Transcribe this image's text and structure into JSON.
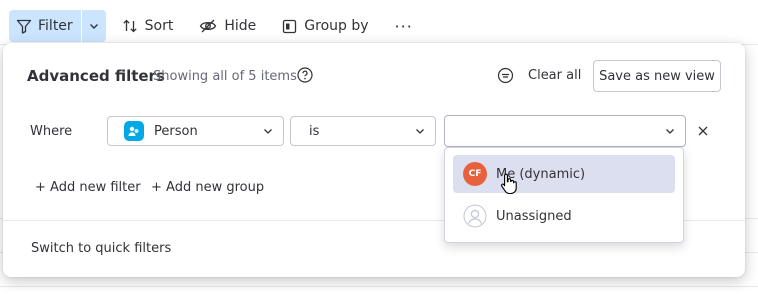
{
  "toolbar": {
    "filter_label": "Filter",
    "sort_label": "Sort",
    "hide_label": "Hide",
    "group_by_label": "Group by",
    "more_label": "···",
    "filter_highlight_color": "#cce5ff"
  },
  "panel": {
    "title": "Advanced filters",
    "subtitle": "Showing all of 5 items",
    "clear_all": "Clear all",
    "save_as_new_view": "Save as new view",
    "where_label": "Where",
    "column_select": {
      "value": "Person",
      "icon": "person-column-icon",
      "icon_color": "#00a9e6"
    },
    "operator_select": {
      "value": "is"
    },
    "value_select": {
      "value": ""
    },
    "add_new_filter": "+ Add new filter",
    "add_new_group": "+ Add new group",
    "switch_to_quick_filters": "Switch to quick filters"
  },
  "dropdown": {
    "options": [
      {
        "label": "Me (dynamic)",
        "avatar_initials": "CF",
        "avatar_color": "#e8613f",
        "highlighted": true
      },
      {
        "label": "Unassigned",
        "avatar_initials": "",
        "highlighted": false
      }
    ]
  }
}
